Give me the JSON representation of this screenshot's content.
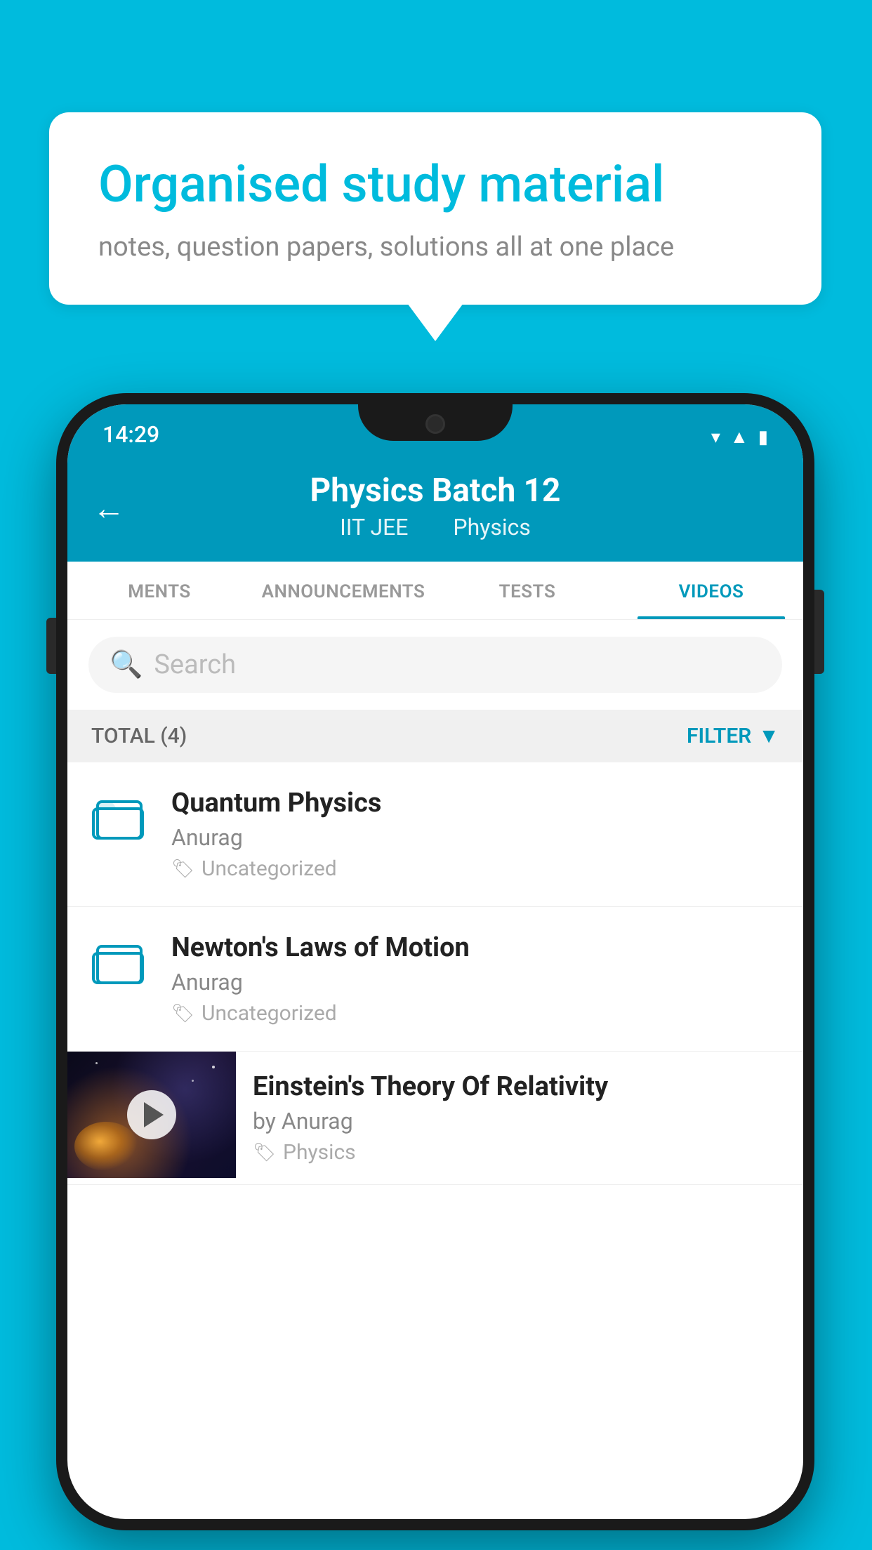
{
  "background": {
    "color": "#00BBDD"
  },
  "speech_bubble": {
    "title": "Organised study material",
    "subtitle": "notes, question papers, solutions all at one place"
  },
  "phone": {
    "status_bar": {
      "time": "14:29"
    },
    "header": {
      "title": "Physics Batch 12",
      "tag1": "IIT JEE",
      "tag2": "Physics",
      "back_label": "←"
    },
    "tabs": [
      {
        "label": "MENTS",
        "active": false
      },
      {
        "label": "ANNOUNCEMENTS",
        "active": false
      },
      {
        "label": "TESTS",
        "active": false
      },
      {
        "label": "VIDEOS",
        "active": true
      }
    ],
    "search": {
      "placeholder": "Search"
    },
    "filter_bar": {
      "total": "TOTAL (4)",
      "filter_label": "FILTER"
    },
    "list_items": [
      {
        "title": "Quantum Physics",
        "author": "Anurag",
        "tag": "Uncategorized",
        "type": "folder"
      },
      {
        "title": "Newton's Laws of Motion",
        "author": "Anurag",
        "tag": "Uncategorized",
        "type": "folder"
      }
    ],
    "video_item": {
      "title": "Einstein's Theory Of Relativity",
      "author": "by Anurag",
      "tag": "Physics",
      "type": "video"
    }
  }
}
